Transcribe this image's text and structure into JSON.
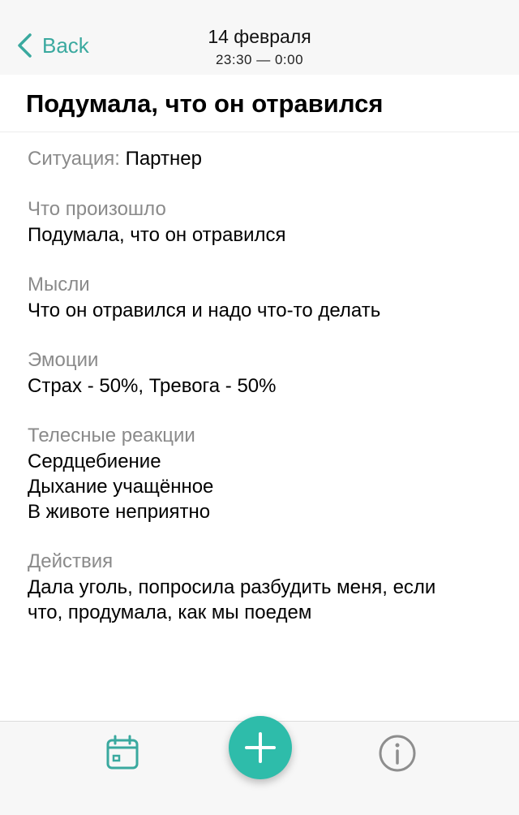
{
  "nav": {
    "back_label": "Back",
    "title": "14 февраля",
    "subtitle": "23:30 — 0:00"
  },
  "entry": {
    "headline": "Подумала, что он отравился",
    "situation_label": "Ситуация:",
    "situation_value": "Партнер",
    "sections": [
      {
        "label": "Что произошло",
        "lines": [
          "Подумала, что он отравился"
        ]
      },
      {
        "label": "Мысли",
        "lines": [
          "Что он отравился и надо что-то делать"
        ]
      },
      {
        "label": "Эмоции",
        "lines": [
          "Страх - 50%, Тревога - 50%"
        ]
      },
      {
        "label": "Телесные реакции",
        "lines": [
          "Сердцебиение",
          "Дыхание учащённое",
          "В животе неприятно"
        ]
      },
      {
        "label": "Действия",
        "lines": [
          "Дала уголь, попросила разбудить меня, если",
          "что, продумала, как мы поедем"
        ]
      }
    ]
  },
  "tabbar": {
    "icons": [
      "calendar-icon",
      "plus-icon",
      "info-icon"
    ],
    "accent_color": "#2ebcaa",
    "icon_color_active": "#3aa99f",
    "icon_color_inactive": "#8e8e8e"
  }
}
